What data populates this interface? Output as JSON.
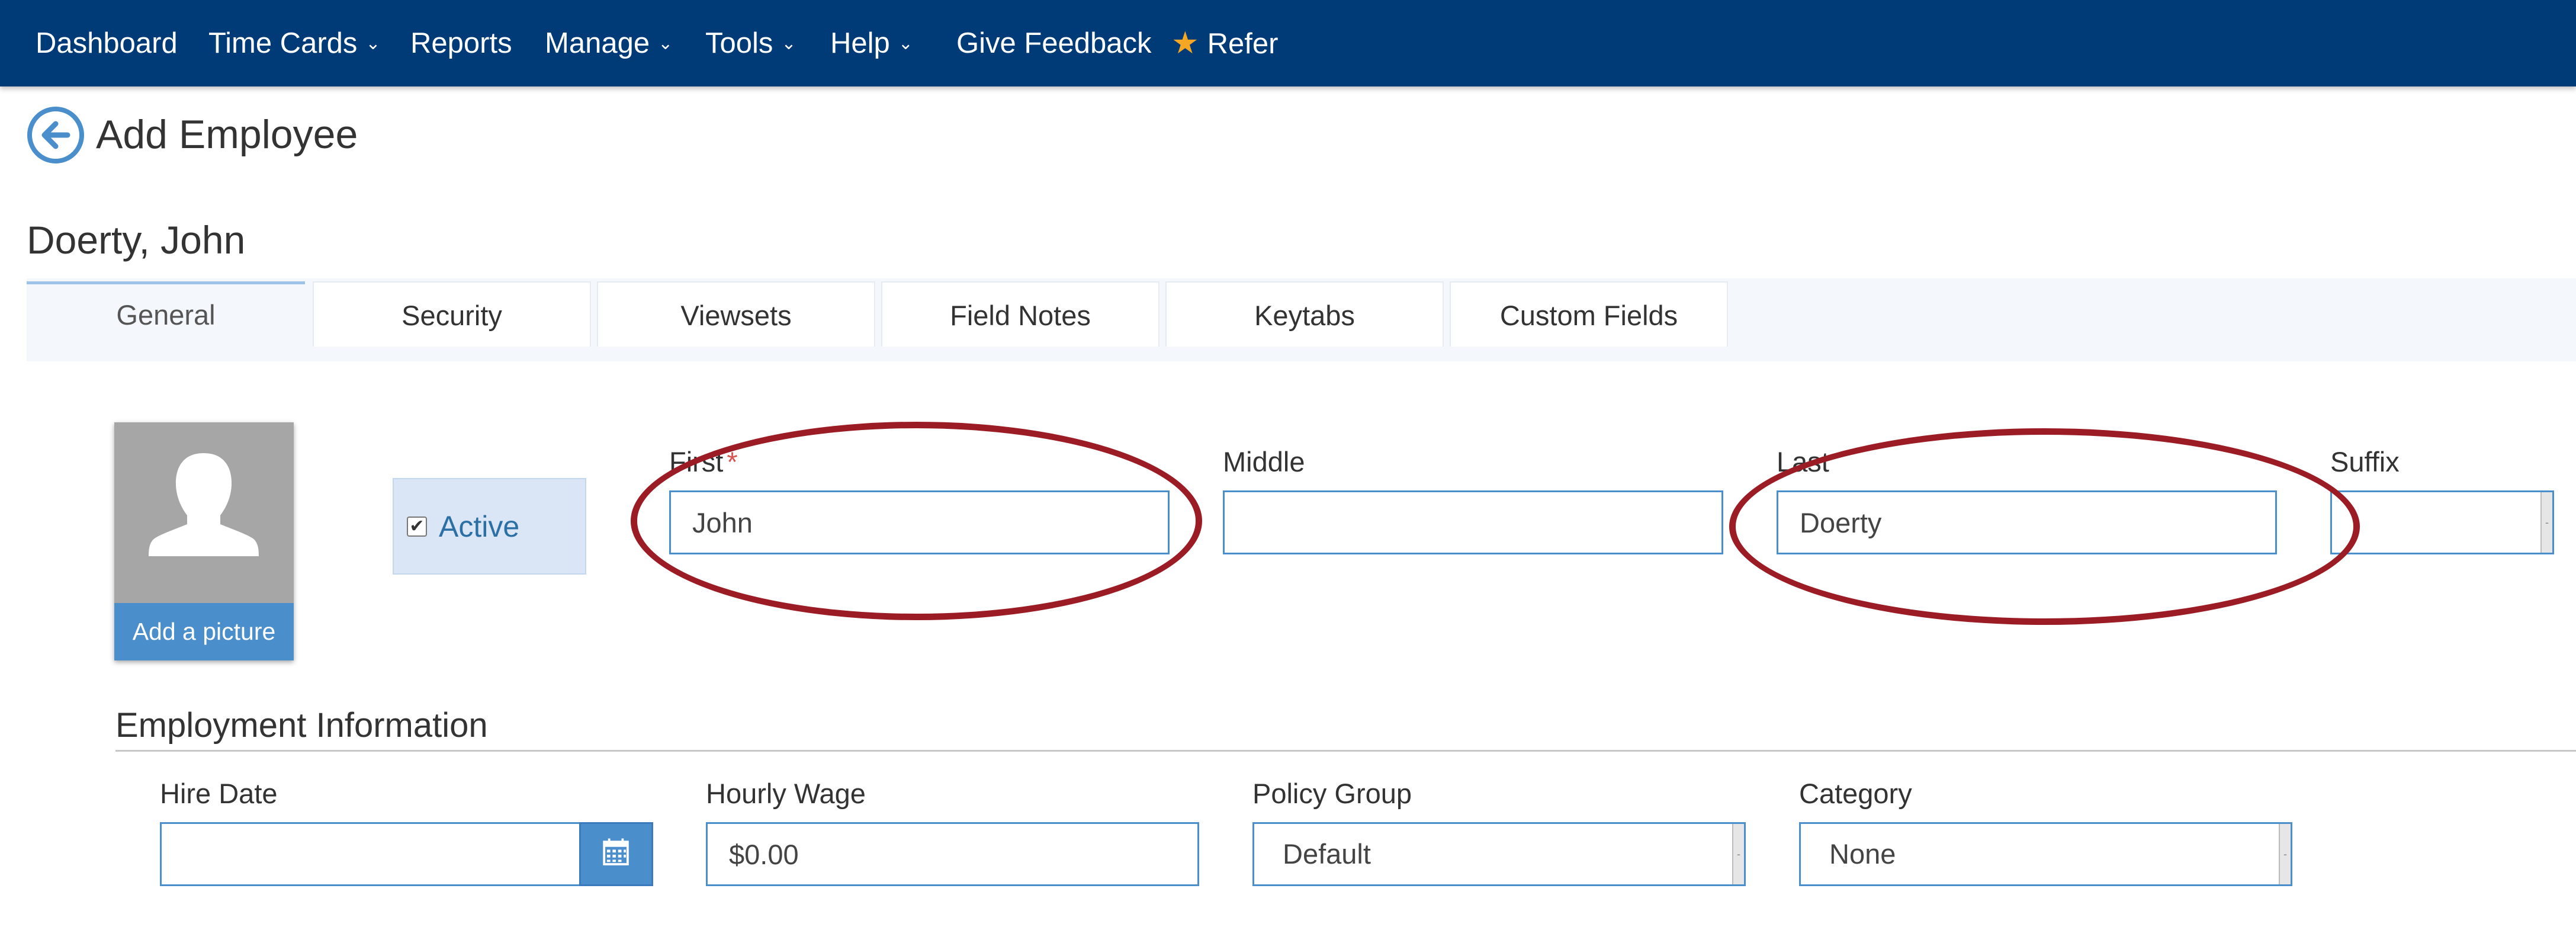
{
  "nav": {
    "items": [
      {
        "label": "Dashboard",
        "has_dropdown": false
      },
      {
        "label": "Time Cards",
        "has_dropdown": true
      },
      {
        "label": "Reports",
        "has_dropdown": false
      },
      {
        "label": "Manage",
        "has_dropdown": true
      },
      {
        "label": "Tools",
        "has_dropdown": true
      },
      {
        "label": "Help",
        "has_dropdown": true
      },
      {
        "label": "Give Feedback",
        "has_dropdown": false
      },
      {
        "label": "Refer",
        "icon": "star-icon"
      }
    ],
    "background": "#003b78",
    "star_color": "#f5a623"
  },
  "page": {
    "title": "Add Employee",
    "back_icon": "back-arrow-circle-icon",
    "employee_name": "Doerty, John"
  },
  "tabs": [
    {
      "label": "General",
      "active": true
    },
    {
      "label": "Security",
      "active": false
    },
    {
      "label": "Viewsets",
      "active": false
    },
    {
      "label": "Field Notes",
      "active": false
    },
    {
      "label": "Keytabs",
      "active": false
    },
    {
      "label": "Custom Fields",
      "active": false
    }
  ],
  "avatar": {
    "icon": "user-silhouette-icon",
    "add_picture_label": "Add a picture"
  },
  "active": {
    "label": "Active",
    "checked": true
  },
  "name_fields": {
    "first": {
      "label": "First",
      "required_mark": "*",
      "value": "John"
    },
    "middle": {
      "label": "Middle",
      "value": ""
    },
    "last": {
      "label": "Last",
      "value": "Doerty"
    },
    "suffix": {
      "label": "Suffix",
      "value": ""
    }
  },
  "employment": {
    "section_title": "Employment Information",
    "hire_date": {
      "label": "Hire Date",
      "value": "",
      "icon": "calendar-icon"
    },
    "hourly_wage": {
      "label": "Hourly Wage",
      "value": "$0.00"
    },
    "policy_group": {
      "label": "Policy Group",
      "value": "Default"
    },
    "category": {
      "label": "Category",
      "value": "None"
    }
  },
  "colors": {
    "accent": "#4a8fcc",
    "annotation": "#9b1c24"
  }
}
